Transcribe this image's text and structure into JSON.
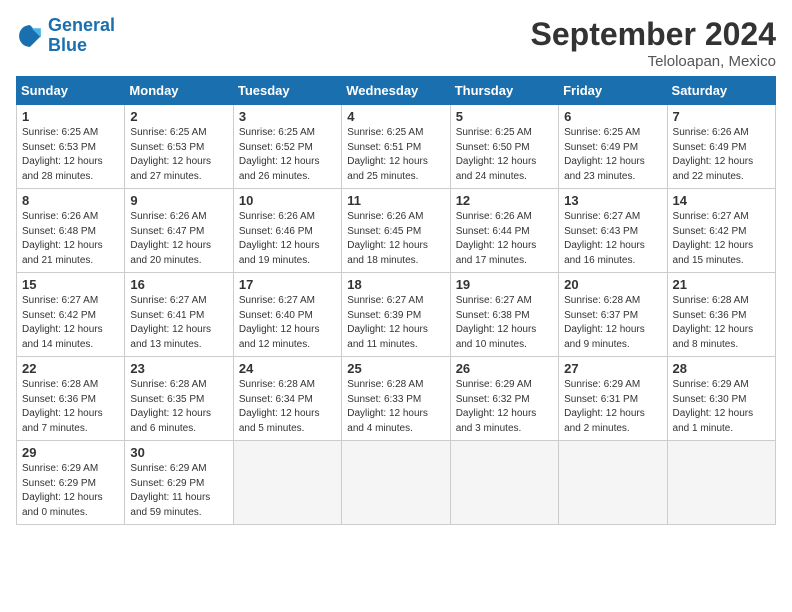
{
  "logo": {
    "line1": "General",
    "line2": "Blue"
  },
  "title": "September 2024",
  "location": "Teloloapan, Mexico",
  "headers": [
    "Sunday",
    "Monday",
    "Tuesday",
    "Wednesday",
    "Thursday",
    "Friday",
    "Saturday"
  ],
  "weeks": [
    [
      {
        "day": "1",
        "lines": [
          "Sunrise: 6:25 AM",
          "Sunset: 6:53 PM",
          "Daylight: 12 hours",
          "and 28 minutes."
        ]
      },
      {
        "day": "2",
        "lines": [
          "Sunrise: 6:25 AM",
          "Sunset: 6:53 PM",
          "Daylight: 12 hours",
          "and 27 minutes."
        ]
      },
      {
        "day": "3",
        "lines": [
          "Sunrise: 6:25 AM",
          "Sunset: 6:52 PM",
          "Daylight: 12 hours",
          "and 26 minutes."
        ]
      },
      {
        "day": "4",
        "lines": [
          "Sunrise: 6:25 AM",
          "Sunset: 6:51 PM",
          "Daylight: 12 hours",
          "and 25 minutes."
        ]
      },
      {
        "day": "5",
        "lines": [
          "Sunrise: 6:25 AM",
          "Sunset: 6:50 PM",
          "Daylight: 12 hours",
          "and 24 minutes."
        ]
      },
      {
        "day": "6",
        "lines": [
          "Sunrise: 6:25 AM",
          "Sunset: 6:49 PM",
          "Daylight: 12 hours",
          "and 23 minutes."
        ]
      },
      {
        "day": "7",
        "lines": [
          "Sunrise: 6:26 AM",
          "Sunset: 6:49 PM",
          "Daylight: 12 hours",
          "and 22 minutes."
        ]
      }
    ],
    [
      {
        "day": "8",
        "lines": [
          "Sunrise: 6:26 AM",
          "Sunset: 6:48 PM",
          "Daylight: 12 hours",
          "and 21 minutes."
        ]
      },
      {
        "day": "9",
        "lines": [
          "Sunrise: 6:26 AM",
          "Sunset: 6:47 PM",
          "Daylight: 12 hours",
          "and 20 minutes."
        ]
      },
      {
        "day": "10",
        "lines": [
          "Sunrise: 6:26 AM",
          "Sunset: 6:46 PM",
          "Daylight: 12 hours",
          "and 19 minutes."
        ]
      },
      {
        "day": "11",
        "lines": [
          "Sunrise: 6:26 AM",
          "Sunset: 6:45 PM",
          "Daylight: 12 hours",
          "and 18 minutes."
        ]
      },
      {
        "day": "12",
        "lines": [
          "Sunrise: 6:26 AM",
          "Sunset: 6:44 PM",
          "Daylight: 12 hours",
          "and 17 minutes."
        ]
      },
      {
        "day": "13",
        "lines": [
          "Sunrise: 6:27 AM",
          "Sunset: 6:43 PM",
          "Daylight: 12 hours",
          "and 16 minutes."
        ]
      },
      {
        "day": "14",
        "lines": [
          "Sunrise: 6:27 AM",
          "Sunset: 6:42 PM",
          "Daylight: 12 hours",
          "and 15 minutes."
        ]
      }
    ],
    [
      {
        "day": "15",
        "lines": [
          "Sunrise: 6:27 AM",
          "Sunset: 6:42 PM",
          "Daylight: 12 hours",
          "and 14 minutes."
        ]
      },
      {
        "day": "16",
        "lines": [
          "Sunrise: 6:27 AM",
          "Sunset: 6:41 PM",
          "Daylight: 12 hours",
          "and 13 minutes."
        ]
      },
      {
        "day": "17",
        "lines": [
          "Sunrise: 6:27 AM",
          "Sunset: 6:40 PM",
          "Daylight: 12 hours",
          "and 12 minutes."
        ]
      },
      {
        "day": "18",
        "lines": [
          "Sunrise: 6:27 AM",
          "Sunset: 6:39 PM",
          "Daylight: 12 hours",
          "and 11 minutes."
        ]
      },
      {
        "day": "19",
        "lines": [
          "Sunrise: 6:27 AM",
          "Sunset: 6:38 PM",
          "Daylight: 12 hours",
          "and 10 minutes."
        ]
      },
      {
        "day": "20",
        "lines": [
          "Sunrise: 6:28 AM",
          "Sunset: 6:37 PM",
          "Daylight: 12 hours",
          "and 9 minutes."
        ]
      },
      {
        "day": "21",
        "lines": [
          "Sunrise: 6:28 AM",
          "Sunset: 6:36 PM",
          "Daylight: 12 hours",
          "and 8 minutes."
        ]
      }
    ],
    [
      {
        "day": "22",
        "lines": [
          "Sunrise: 6:28 AM",
          "Sunset: 6:36 PM",
          "Daylight: 12 hours",
          "and 7 minutes."
        ]
      },
      {
        "day": "23",
        "lines": [
          "Sunrise: 6:28 AM",
          "Sunset: 6:35 PM",
          "Daylight: 12 hours",
          "and 6 minutes."
        ]
      },
      {
        "day": "24",
        "lines": [
          "Sunrise: 6:28 AM",
          "Sunset: 6:34 PM",
          "Daylight: 12 hours",
          "and 5 minutes."
        ]
      },
      {
        "day": "25",
        "lines": [
          "Sunrise: 6:28 AM",
          "Sunset: 6:33 PM",
          "Daylight: 12 hours",
          "and 4 minutes."
        ]
      },
      {
        "day": "26",
        "lines": [
          "Sunrise: 6:29 AM",
          "Sunset: 6:32 PM",
          "Daylight: 12 hours",
          "and 3 minutes."
        ]
      },
      {
        "day": "27",
        "lines": [
          "Sunrise: 6:29 AM",
          "Sunset: 6:31 PM",
          "Daylight: 12 hours",
          "and 2 minutes."
        ]
      },
      {
        "day": "28",
        "lines": [
          "Sunrise: 6:29 AM",
          "Sunset: 6:30 PM",
          "Daylight: 12 hours",
          "and 1 minute."
        ]
      }
    ],
    [
      {
        "day": "29",
        "lines": [
          "Sunrise: 6:29 AM",
          "Sunset: 6:29 PM",
          "Daylight: 12 hours",
          "and 0 minutes."
        ]
      },
      {
        "day": "30",
        "lines": [
          "Sunrise: 6:29 AM",
          "Sunset: 6:29 PM",
          "Daylight: 11 hours",
          "and 59 minutes."
        ]
      },
      null,
      null,
      null,
      null,
      null
    ]
  ]
}
